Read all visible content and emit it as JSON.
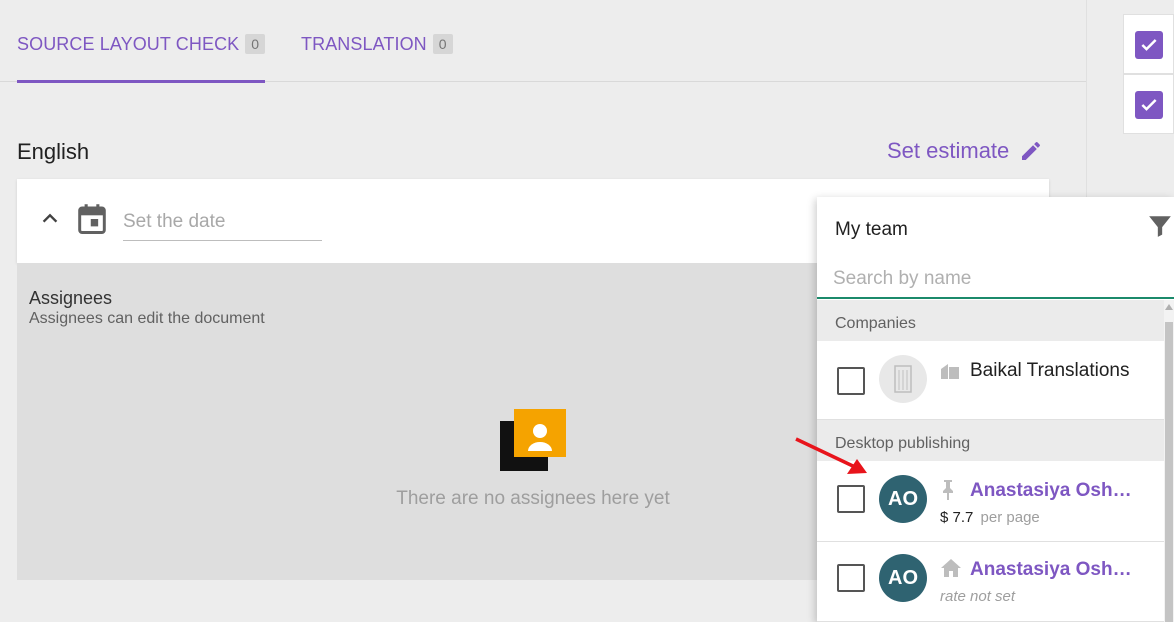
{
  "tabs": [
    {
      "label": "SOURCE LAYOUT CHECK",
      "count": "0"
    },
    {
      "label": "TRANSLATION",
      "count": "0"
    }
  ],
  "language": {
    "title": "English",
    "estimate_label": "Set estimate"
  },
  "date": {
    "placeholder": "Set the date"
  },
  "assignees": {
    "title": "Assignees",
    "subtitle": "Assignees can edit the document",
    "empty_text": "There are no assignees here yet"
  },
  "team_panel": {
    "title": "My team",
    "search_placeholder": "Search by name",
    "sections": [
      {
        "label": "Companies",
        "rows": [
          {
            "name": "Baikal Translations",
            "icon": "company-icon"
          }
        ]
      },
      {
        "label": "Desktop publishing",
        "rows": [
          {
            "initials": "AO",
            "name": "Anastasiya Oshuev",
            "icon": "pin-icon",
            "rate_currency": "$",
            "rate_value": "7.7",
            "rate_unit": "per page"
          },
          {
            "initials": "AO",
            "name": "Anastasiya Oshuev",
            "icon": "home-icon",
            "rate_text": "rate not set"
          }
        ]
      }
    ]
  },
  "colors": {
    "accent": "#7e57c2",
    "avatar": "#2f6371",
    "search_underline": "#1b8a6b",
    "annotation_arrow": "#e8141b"
  }
}
